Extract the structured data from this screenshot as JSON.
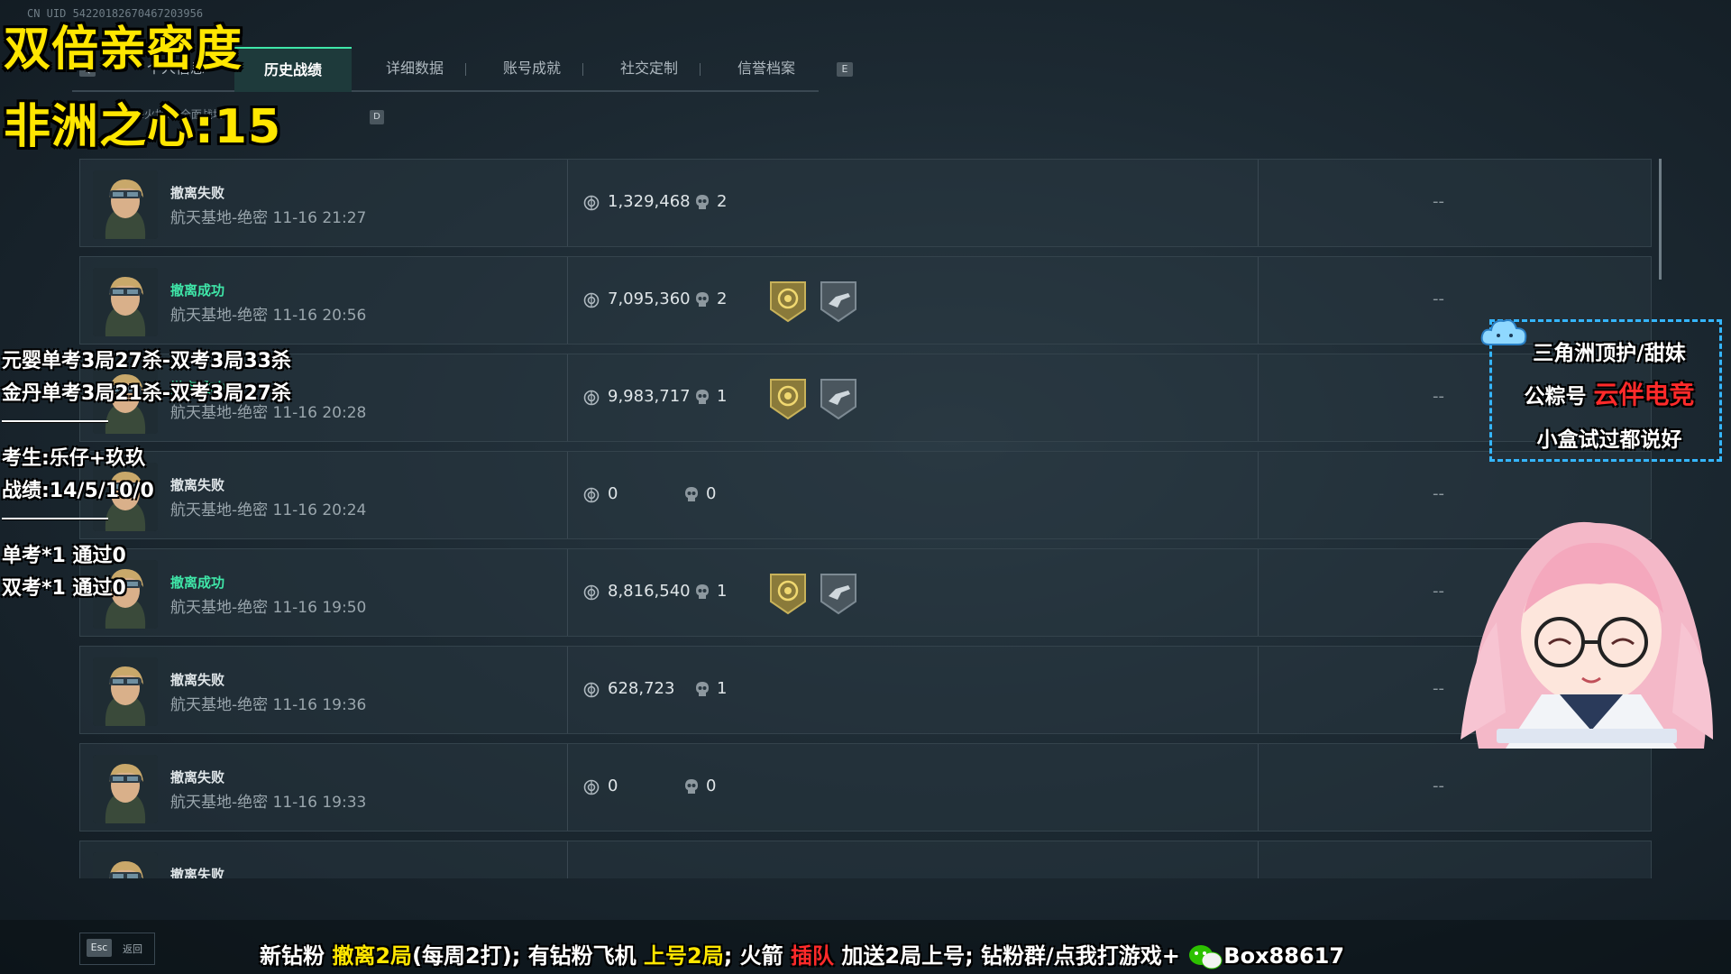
{
  "uid": "CN UID 542201826704672039​56",
  "tabs": {
    "key_left": "Q",
    "key_right": "E",
    "items": [
      {
        "label": "个人信息"
      },
      {
        "label": "历史战绩"
      },
      {
        "label": "详细数据"
      },
      {
        "label": "账号成就"
      },
      {
        "label": "社交定制"
      },
      {
        "label": "信誉档案"
      }
    ]
  },
  "subtab": {
    "label": "烽火地带   全面战场",
    "key": "D"
  },
  "matches": [
    {
      "status": "撤离失败",
      "success": false,
      "map": "航天基地-绝密 11-16 21:27",
      "value": "1,329,468",
      "kills": "2",
      "badges": false,
      "extra": "--"
    },
    {
      "status": "撤离成功",
      "success": true,
      "map": "航天基地-绝密 11-16 20:56",
      "value": "7,095,360",
      "kills": "2",
      "badges": true,
      "extra": "--"
    },
    {
      "status": "撤离成功",
      "success": true,
      "map": "航天基地-绝密 11-16 20:28",
      "value": "9,983,717",
      "kills": "1",
      "badges": true,
      "extra": "--"
    },
    {
      "status": "撤离失败",
      "success": false,
      "map": "航天基地-绝密 11-16 20:24",
      "value": "0",
      "kills": "0",
      "badges": false,
      "extra": "--"
    },
    {
      "status": "撤离成功",
      "success": true,
      "map": "航天基地-绝密 11-16 19:50",
      "value": "8,816,540",
      "kills": "1",
      "badges": true,
      "extra": "--"
    },
    {
      "status": "撤离失败",
      "success": false,
      "map": "航天基地-绝密 11-16 19:36",
      "value": "628,723",
      "kills": "1",
      "badges": false,
      "extra": "--"
    },
    {
      "status": "撤离失败",
      "success": false,
      "map": "航天基地-绝密 11-16 19:33",
      "value": "0",
      "kills": "0",
      "badges": false,
      "extra": "--"
    },
    {
      "status": "撤离失败",
      "success": false,
      "map": "",
      "value": "",
      "kills": "",
      "badges": false,
      "extra": ""
    }
  ],
  "footer": {
    "esc_key": "Esc",
    "esc_label": "返回"
  },
  "overlay": {
    "title1": "双倍亲密度",
    "title2": "非洲之心:15",
    "lines": {
      "l1": "元婴单考3局27杀-双考3局33杀",
      "l2": "金丹单考3局21杀-双考3局27杀",
      "l3": "考生:乐仔+玖玖",
      "l4": "战绩:14/5/10/0",
      "l5": "单考*1 通过0",
      "l6": "双考*1 通过0"
    },
    "ticker": {
      "p1": "新钻粉 ",
      "p2": "撤离2局",
      "p3": "(每周2打); 有钻粉飞机 ",
      "p4": "上号2局",
      "p5": "; 火箭 ",
      "p6": "插队",
      "p7": " 加送2局上号; 钻粉群/点我打游戏+",
      "p8": "Box88617"
    },
    "promo": {
      "line1": "三角洲顶护/甜妹",
      "line2a": "公粽号 ",
      "line2b": "云伴电竞",
      "line3": "小盒试过都说好"
    }
  },
  "colors": {
    "accent": "#3fe6a8",
    "overlay_yellow": "#ffe600",
    "overlay_red": "#ff2a2a",
    "promo_border": "#35b6ff"
  }
}
